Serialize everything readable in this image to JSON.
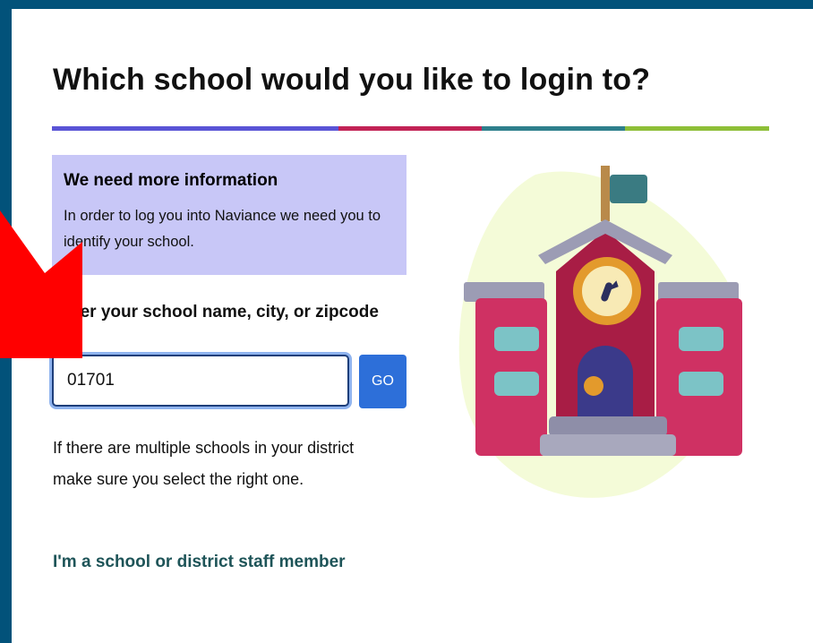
{
  "page": {
    "title": "Which school would you like to login to?"
  },
  "divider": {
    "colors": [
      "#5a54d6",
      "#c22356",
      "#2e7f8c",
      "#8ebf38"
    ]
  },
  "info_box": {
    "heading": "We need more information",
    "body": "In order to log you into Naviance we need you to identify your school."
  },
  "search": {
    "label": "Enter your school name, city, or zipcode",
    "value": "01701",
    "go_label": "GO"
  },
  "help_text": "If there are multiple schools in your district make sure you select the right one.",
  "staff_link": "I'm a school or district staff member",
  "illustration": {
    "icon": "school-building-icon"
  },
  "overlay": {
    "icon": "red-arrow-icon",
    "color": "#ff0000"
  }
}
